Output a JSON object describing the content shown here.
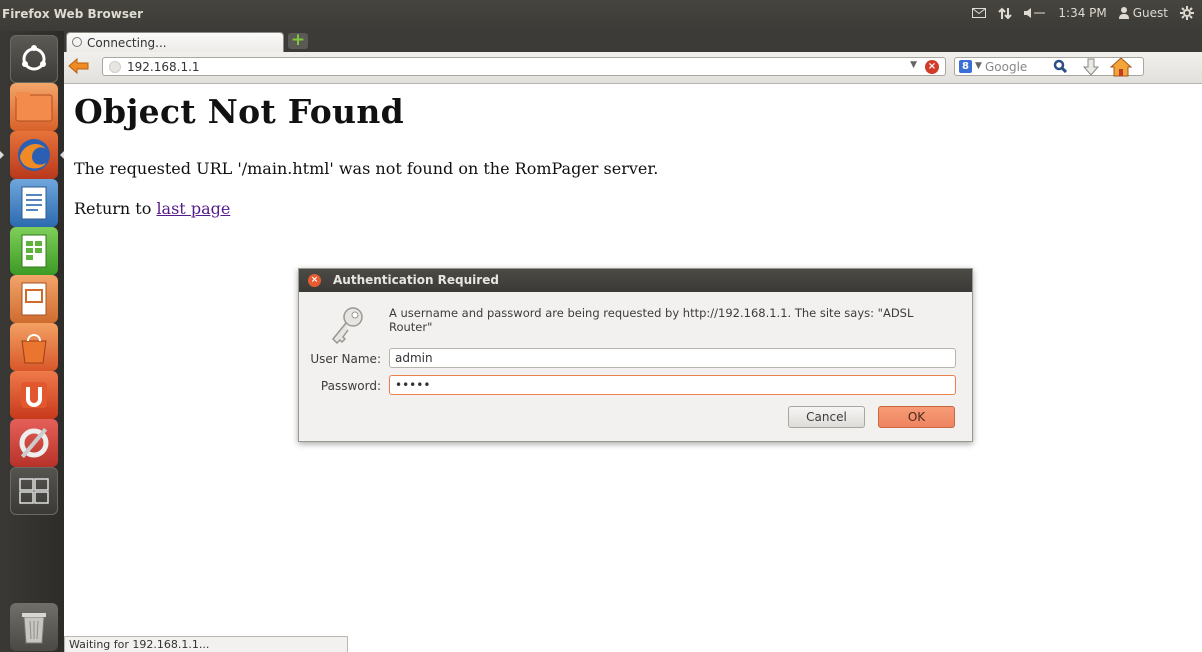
{
  "top_panel": {
    "title": "Firefox Web Browser",
    "clock": "1:34 PM",
    "user": "Guest",
    "icons": [
      "mail-icon",
      "network-icon",
      "volume-icon",
      "user-icon",
      "gear-icon"
    ]
  },
  "launcher": {
    "items": [
      "dash-home",
      "files",
      "firefox",
      "writer",
      "calc",
      "impress",
      "software-center",
      "ubuntu-one",
      "system-settings",
      "workspace-switcher",
      "trash"
    ]
  },
  "tab": {
    "label": "Connecting..."
  },
  "navbar": {
    "url": "192.168.1.1",
    "search_placeholder": "Google"
  },
  "page": {
    "title": "Object Not Found",
    "message": "The requested URL '/main.html' was not found on the RomPager server.",
    "return_prefix": "Return to ",
    "return_link": "last page"
  },
  "dialog": {
    "title": "Authentication Required",
    "message": "A username and password are being requested by http://192.168.1.1. The site says: \"ADSL Router\"",
    "username_label": "User Name:",
    "username_value": "admin",
    "password_label": "Password:",
    "password_value": "•••••",
    "cancel_label": "Cancel",
    "ok_label": "OK"
  },
  "status": {
    "text": "Waiting for 192.168.1.1..."
  },
  "colors": {
    "panel": "#3c3b37",
    "launcher": "#2d2c29",
    "ok_button": "#ee8462",
    "link_visited": "#551a8b"
  }
}
